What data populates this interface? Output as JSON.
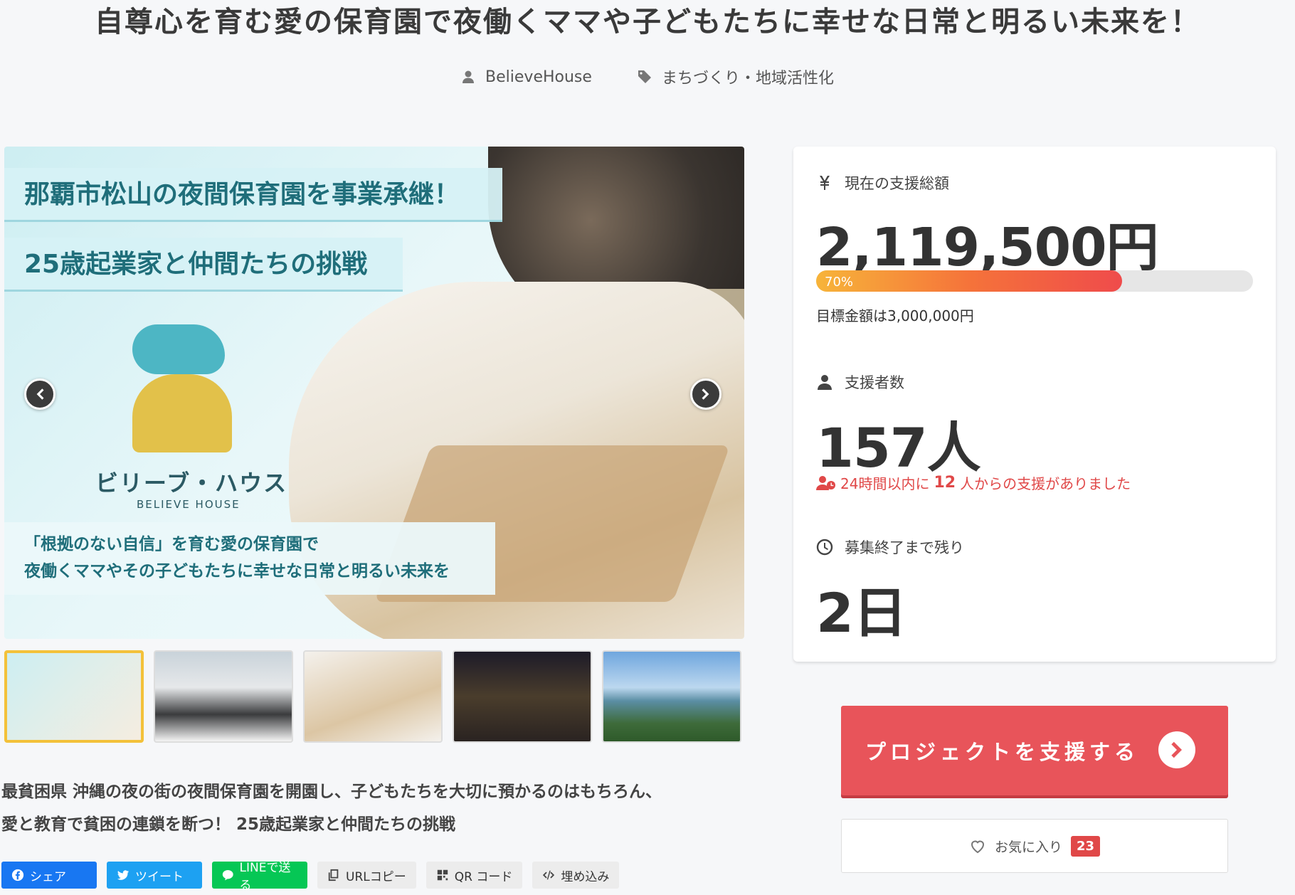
{
  "page": {
    "title": "自尊心を育む愛の保育園で夜働くママや子どもたちに幸せな日常と明るい未来を！",
    "owner": "BelieveHouse",
    "category": "まちづくり・地域活性化"
  },
  "hero": {
    "band1": "那覇市松山の夜間保育園を事業承継！",
    "band2": "25歳起業家と仲間たちの挑戦",
    "logo_text": "ビリーブ・ハウス",
    "logo_sub": "BELIEVE HOUSE",
    "caption1": "「根拠のない自信」を育む愛の保育園で",
    "caption2": "夜働くママやその子どもたちに幸せな日常と明るい未来を"
  },
  "thumbnails": [
    {
      "name": "thumb-flyer"
    },
    {
      "name": "thumb-team"
    },
    {
      "name": "thumb-floorplan"
    },
    {
      "name": "thumb-nightstreet"
    },
    {
      "name": "thumb-seaview"
    }
  ],
  "lead": {
    "line1": "最貧困県 沖縄の夜の街の夜間保育園を開園し、子どもたちを大切に預かるのはもちろん、",
    "line2": "愛と教育で貧困の連鎖を断つ！ 25歳起業家と仲間たちの挑戦"
  },
  "share": {
    "facebook": "シェア",
    "twitter": "ツイート",
    "line": "LINEで送る",
    "url_copy": "URLコピー",
    "qr": "QR コード",
    "embed": "埋め込み"
  },
  "stats": {
    "total_label": "現在の支援総額",
    "total_amount": "2,119,500円",
    "progress_percent": 70,
    "progress_text": "70%",
    "goal_text": "目標金額は3,000,000円",
    "supporters_label": "支援者数",
    "supporters_value": "157人",
    "recent_pre": "24時間以内に",
    "recent_count": "12",
    "recent_post": "人からの支援がありました",
    "remaining_label": "募集終了まで残り",
    "remaining_value": "2日"
  },
  "cta": {
    "support_label": "プロジェクトを支援する"
  },
  "favorite": {
    "label": "お気に入り",
    "count": "23"
  },
  "colors": {
    "accent": "#e8545a",
    "progress_start": "#f7b43a",
    "progress_end": "#ef4b4b",
    "badge": "#e04848"
  }
}
